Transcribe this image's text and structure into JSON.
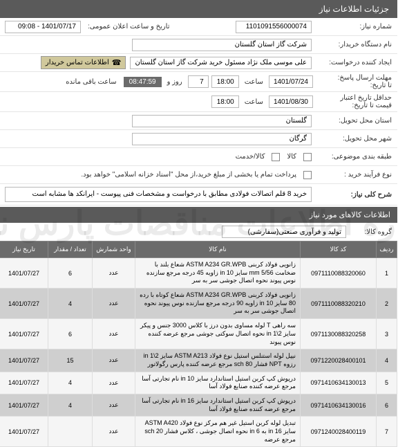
{
  "titlebar": {
    "title": "جزئیات اطلاعات نیاز"
  },
  "fields": {
    "need_no_label": "شماره نیاز:",
    "need_no": "1101091556000074",
    "announce_label": "تاریخ و ساعت اعلان عمومی:",
    "announce_value": "1401/07/17 - 09:08",
    "buyer_org_label": "نام دستگاه خریدار:",
    "buyer_org": "شرکت گاز استان گلستان",
    "requester_label": "ایجاد کننده درخواست:",
    "requester": "علی موسی ملک نژاد مسئول خرید شرکت گاز استان گلستان",
    "contact_label": "اطلاعات تماس خریدار",
    "deadline_label": "مهلت ارسال پاسخ:",
    "until_label": "تا تاریخ:",
    "deadline_date": "1401/07/24",
    "time_label": "ساعت",
    "deadline_time": "18:00",
    "deadline_days": "7",
    "days_label": "روز و",
    "countdown": "08:47:59",
    "remaining_label": "ساعت باقی مانده",
    "validity_label": "حداقل تاریخ اعتبار",
    "price_until_label": "قیمت تا تاریخ:",
    "validity_date": "1401/08/30",
    "validity_time": "18:00",
    "province_label": "استان محل تحویل:",
    "province": "گلستان",
    "city_label": "شهر محل تحویل:",
    "city": "گرگان",
    "category_label": "طبقه بندی موضوعی:",
    "goods_label": "کالا",
    "service_label": "کالا/خدمت",
    "process_label": "نوع فرآیند خرید :",
    "payment_note": "پرداخت تمام یا بخشی از مبلغ خرید،از محل \"اسناد خزانه اسلامی\" خواهد بود."
  },
  "sections": {
    "need_desc_title": "شرح کلی نیاز:",
    "need_desc": "خرید 8 قلم اتصالات فولادی  مطابق با درخواست و مشخصات فنی پیوست - ایرانکد ها مشابه است",
    "goods_info_title": "اطلاعات کالاهای مورد نیاز",
    "group_label": "گروه کالا:",
    "group_value": "تولید و فرآوری صنعتی(سفارشی)"
  },
  "table": {
    "headers": {
      "idx": "ردیف",
      "code": "کد کالا",
      "name": "نام کالا",
      "unit": "واحد شمارش",
      "qty": "تعداد / مقدار",
      "date": "تاریخ نیاز"
    },
    "rows": [
      {
        "idx": "1",
        "code": "0971110088320060",
        "name": "زانویی فولاد کربنی ASTM A234 GR.WPB شعاع بلند با ضخامت mm 5/56 سایز in 10 زاویه 45 درجه مرجع سازنده نوس پیوند نحوه اتصال جوشی سر به سر",
        "unit": "عدد",
        "qty": "6",
        "date": "1401/07/27"
      },
      {
        "idx": "2",
        "code": "0971110088320210",
        "name": "زانویی فولاد کربنی ASTM A234 GR.WPB شعاع کوتاه با رده 80 سایز in 10 زاویه 90 درجه مرجع سازنده نوس پیوند نحوه اتصال جوشی سر به سر",
        "unit": "عدد",
        "qty": "4",
        "date": "1401/07/27"
      },
      {
        "idx": "3",
        "code": "0971130088320258",
        "name": "سه راهی T لوله مساوی بدون درز با کلاس 3000 جنس و پیکر سایز in 1\\2 نحوه اتصال سوکتی جوشی مرجع عرضه کننده نوس پیوند",
        "unit": "عدد",
        "qty": "6",
        "date": "1401/07/27"
      },
      {
        "idx": "4",
        "code": "0971220028400101",
        "name": "نیپل لوله استنلس استیل نوع فولاد ASTM A213 سایز in 1\\2 رزوه NPT فشار sch 80 مرجع عرضه کننده پارس رگولاتور",
        "unit": "عدد",
        "qty": "15",
        "date": "1401/07/27"
      },
      {
        "idx": "5",
        "code": "0971410634130013",
        "name": "درپوش کپ کربن استیل استاندارد سایز in 10 نام تجارتی آسا مرجع عرضه کننده صنایع فولاد آسا",
        "unit": "عدد",
        "qty": "4",
        "date": "1401/07/27"
      },
      {
        "idx": "6",
        "code": "0971410634130016",
        "name": "درپوش کپ کربن استیل استاندارد سایز in 16 نام تجارتی آسا مرجع عرضه کننده صنایع فولاد آسا",
        "unit": "عدد",
        "qty": "4",
        "date": "1401/07/27"
      },
      {
        "idx": "7",
        "code": "0971240028400119",
        "name": "تبدیل لوله کربن استیل غیر هم مرکز نوع فولاد ASTM A420 سایز in 16 به in 6 نحوه اتصال جوشی ، کلاس فشار sch 20 مرجع عرضه",
        "unit": "عدد",
        "qty": "",
        "date": "1401/07/27"
      }
    ]
  }
}
